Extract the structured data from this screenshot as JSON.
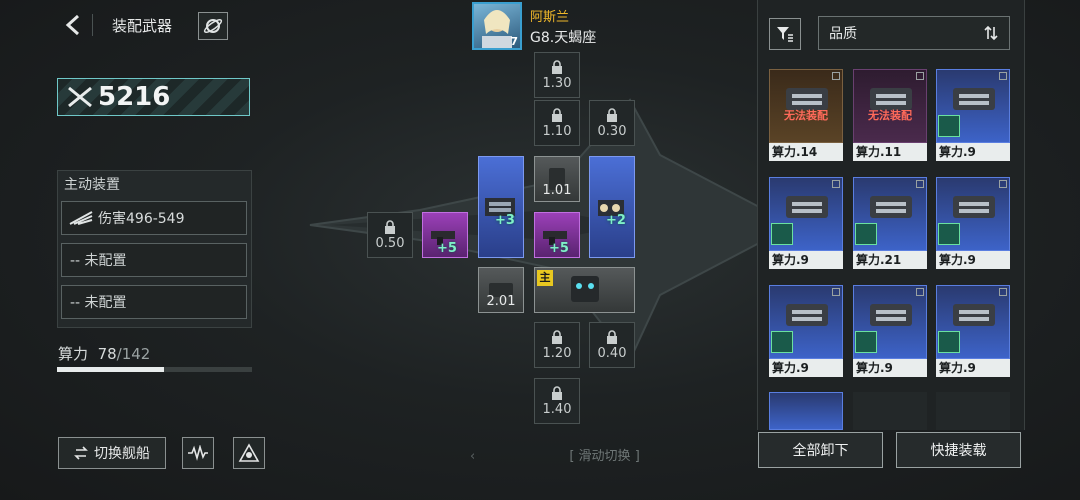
{
  "header": {
    "title": "装配武器"
  },
  "combat_power": "5216",
  "active_gear": {
    "title": "主动装置",
    "slots": [
      "伤害496-549",
      "-- 未配置",
      "-- 未配置"
    ]
  },
  "compute": {
    "label": "算力",
    "used": "78",
    "total": "/142",
    "fraction": 0.55
  },
  "buttons": {
    "switch_ship": "切换舰船",
    "unequip_all": "全部卸下",
    "quick_equip": "快捷装载"
  },
  "pilot": {
    "name": "阿斯兰",
    "rank": "G8.天蝎座",
    "level": "7"
  },
  "slots": {
    "locked": [
      "1.30",
      "1.10",
      "0.30",
      "0.50",
      "1.20",
      "0.40",
      "1.40"
    ],
    "equipped_bonus": [
      "+5",
      "+3",
      "+5",
      "+2"
    ],
    "grey_values": [
      "1.01",
      "2.01"
    ],
    "main_tag": "主"
  },
  "swipe_hint": "滑动切换",
  "inventory": {
    "sort_label": "品质",
    "cards": [
      {
        "label": "算力.14",
        "warn": "无法装配"
      },
      {
        "label": "算力.11",
        "warn": "无法装配"
      },
      {
        "label": "算力.9",
        "warn": ""
      },
      {
        "label": "算力.9",
        "warn": ""
      },
      {
        "label": "算力.21",
        "warn": ""
      },
      {
        "label": "算力.9",
        "warn": ""
      },
      {
        "label": "算力.9",
        "warn": ""
      },
      {
        "label": "算力.9",
        "warn": ""
      },
      {
        "label": "算力.9",
        "warn": ""
      }
    ]
  },
  "colors": {
    "accent": "#6fc8c8",
    "warning": "#ff6a5a",
    "rank_gold": "#f0b82a"
  }
}
